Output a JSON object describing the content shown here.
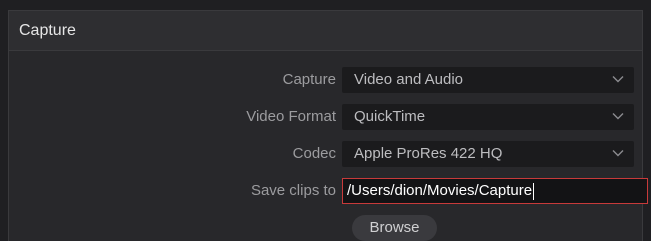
{
  "panel": {
    "title": "Capture"
  },
  "form": {
    "capture": {
      "label": "Capture",
      "value": "Video and Audio",
      "icon": "chevron-down-icon"
    },
    "video_format": {
      "label": "Video Format",
      "value": "QuickTime",
      "icon": "chevron-down-icon"
    },
    "codec": {
      "label": "Codec",
      "value": "Apple ProRes 422 HQ",
      "icon": "chevron-down-icon"
    },
    "save_clips": {
      "label": "Save clips to",
      "value": "/Users/dion/Movies/Capture"
    },
    "browse_label": "Browse"
  },
  "colors": {
    "input_focus_border": "#c83a3a",
    "panel_bg": "#28282b",
    "field_bg": "#1b1b1d"
  }
}
